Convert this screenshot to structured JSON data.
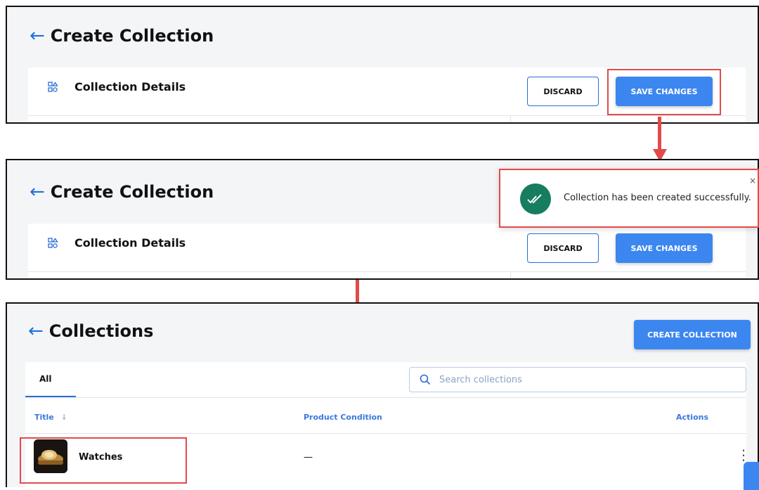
{
  "panel1": {
    "title": "Create Collection",
    "section_label": "Collection Details",
    "discard_label": "DISCARD",
    "save_label": "SAVE CHANGES"
  },
  "panel2": {
    "title": "Create Collection",
    "section_label": "Collection Details",
    "discard_label": "DISCARD",
    "save_label": "SAVE CHANGES",
    "toast": {
      "message": "Collection has been created successfully.",
      "close": "×"
    }
  },
  "panel3": {
    "title": "Collections",
    "create_label": "CREATE COLLECTION",
    "tab_all": "All",
    "search_placeholder": "Search collections",
    "columns": {
      "title": "Title",
      "sort_icon": "↓",
      "condition": "Product Condition",
      "actions": "Actions"
    },
    "rows": [
      {
        "title": "Watches",
        "condition": "—",
        "actions": "⋮"
      }
    ]
  },
  "icons": {
    "back": "←",
    "collection_details": "collection-grid-icon",
    "success": "double-check-icon",
    "search": "search-icon",
    "more": "more-vertical-icon"
  },
  "colors": {
    "accent": "#3c86f0",
    "highlight": "#e24a4a",
    "success": "#167d5f",
    "link": "#3a79dc"
  }
}
